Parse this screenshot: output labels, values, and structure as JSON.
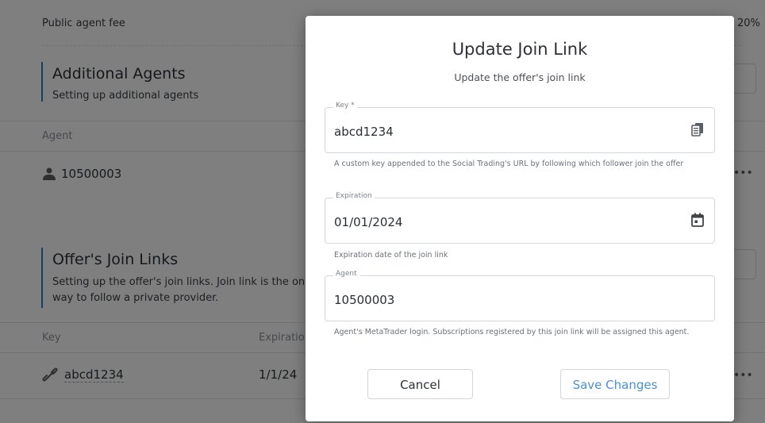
{
  "background": {
    "public_fee": {
      "label": "Public agent fee",
      "value": "20%"
    },
    "additional_agents": {
      "title": "Additional Agents",
      "subtitle": "Setting up additional agents",
      "column_agent": "Agent",
      "rows": [
        {
          "agent": "10500003",
          "menu": "•••"
        }
      ]
    },
    "join_links": {
      "title": "Offer's Join Links",
      "subtitle_line1": "Setting up the offer's join links. Join link is the onl",
      "subtitle_line2": "way to follow a private provider.",
      "column_key": "Key",
      "column_expiration": "Expiratio",
      "rows": [
        {
          "key": "abcd1234",
          "expiration": "1/1/24",
          "menu": "•••"
        }
      ]
    }
  },
  "modal": {
    "title": "Update Join Link",
    "subtitle": "Update the offer's join link",
    "key": {
      "label": "Key *",
      "value": "abcd1234",
      "help": "A custom key appended to the Social Trading's URL by following which follower join the offer",
      "icon": "copy-icon"
    },
    "expiration": {
      "label": "Expiration",
      "value": "01/01/2024",
      "help": "Expiration date of the join link",
      "icon": "calendar-icon"
    },
    "agent": {
      "label": "Agent",
      "value": "10500003",
      "help": "Agent's MetaTrader login. Subscriptions registered by this join link will be assigned this agent."
    },
    "cancel_label": "Cancel",
    "save_label": "Save Changes"
  },
  "colors": {
    "accent": "#2c7fc5",
    "save_text": "#4a90d9",
    "overlay": "rgba(0,0,0,0.5)"
  }
}
